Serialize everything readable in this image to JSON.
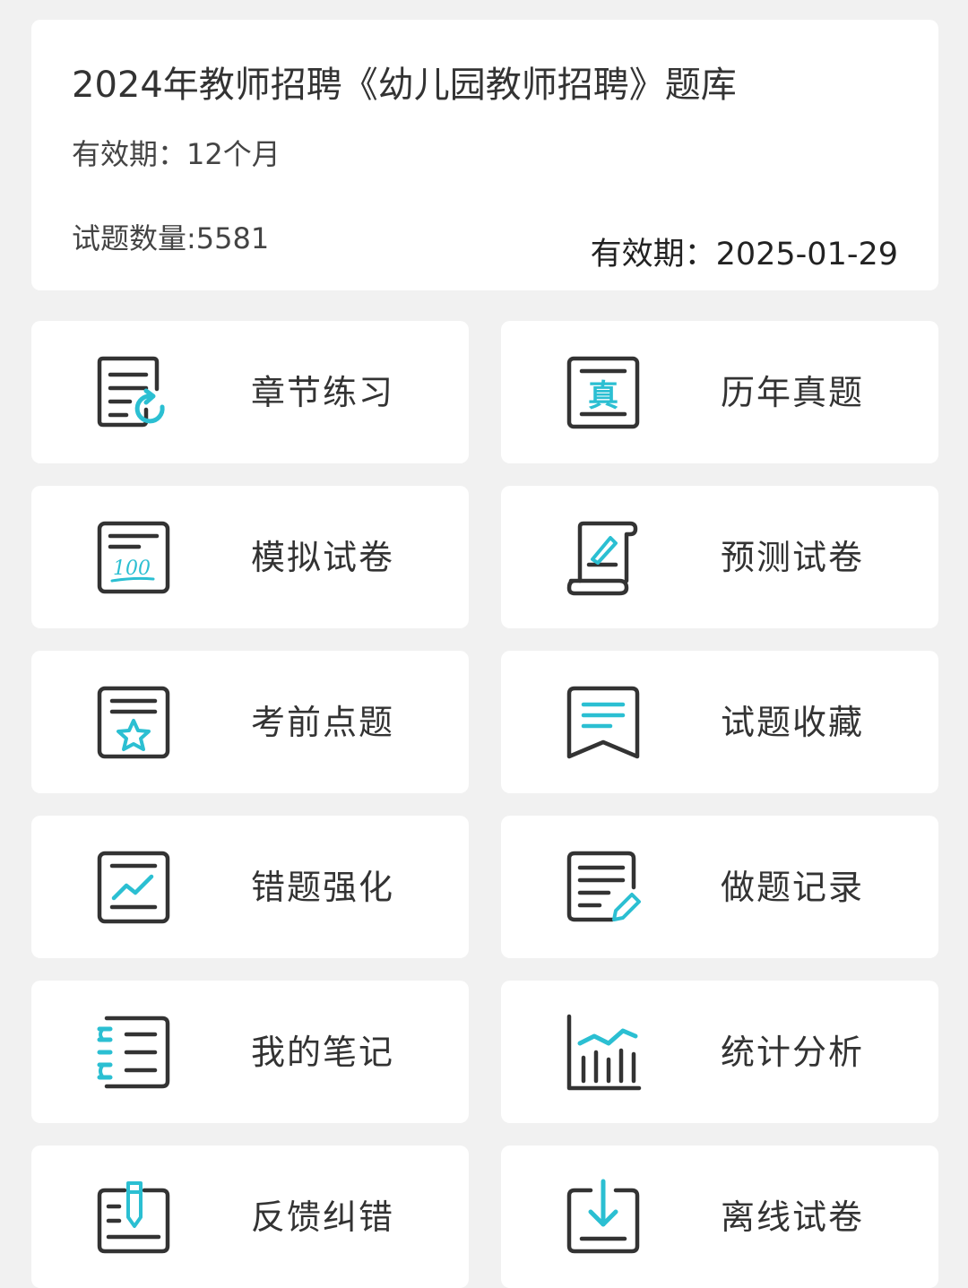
{
  "header": {
    "title": "2024年教师招聘《幼儿园教师招聘》题库",
    "validity": "有效期：12个月",
    "question_count": "试题数量:5581",
    "expire": "有效期：2025-01-29"
  },
  "colors": {
    "accent": "#2bbfd2",
    "icon_stroke": "#333333",
    "background": "#f1f1f1",
    "card": "#ffffff"
  },
  "menu": [
    {
      "label": "章节练习",
      "icon": "chapter-practice-icon"
    },
    {
      "label": "历年真题",
      "icon": "past-exams-icon"
    },
    {
      "label": "模拟试卷",
      "icon": "mock-paper-icon"
    },
    {
      "label": "预测试卷",
      "icon": "forecast-paper-icon"
    },
    {
      "label": "考前点题",
      "icon": "pre-exam-tips-icon"
    },
    {
      "label": "试题收藏",
      "icon": "favorites-icon"
    },
    {
      "label": "错题强化",
      "icon": "wrong-questions-icon"
    },
    {
      "label": "做题记录",
      "icon": "practice-record-icon"
    },
    {
      "label": "我的笔记",
      "icon": "notes-icon"
    },
    {
      "label": "统计分析",
      "icon": "statistics-icon"
    },
    {
      "label": "反馈纠错",
      "icon": "feedback-icon"
    },
    {
      "label": "离线试卷",
      "icon": "offline-paper-icon"
    }
  ]
}
